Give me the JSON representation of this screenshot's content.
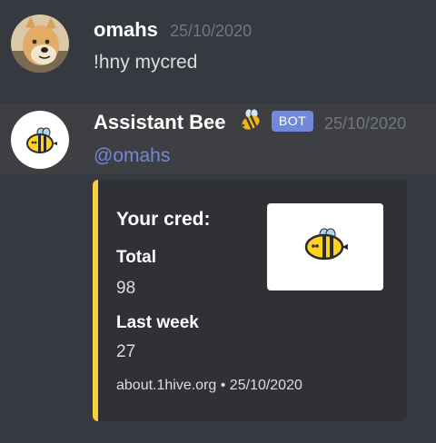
{
  "messages": [
    {
      "author": "omahs",
      "timestamp": "25/10/2020",
      "avatar_icon": "doge-avatar",
      "content": "!hny mycred"
    },
    {
      "author": "Assistant Bee",
      "author_emoji_icon": "bee-icon",
      "badge": "BOT",
      "timestamp": "25/10/2020",
      "avatar_icon": "bee-avatar",
      "mention": "@omahs",
      "embed": {
        "accent_color": "#f4d03f",
        "title": "Your cred:",
        "fields": [
          {
            "name": "Total",
            "value": "98"
          },
          {
            "name": "Last week",
            "value": "27"
          }
        ],
        "footer": "about.1hive.org • 25/10/2020",
        "thumbnail_icon": "bee-icon"
      }
    }
  ],
  "colors": {
    "background": "#36393f",
    "highlight_row": "#3e3f43",
    "embed_bg": "#2f3136",
    "mention": "#7289da",
    "bot_badge": "#7289da",
    "timestamp": "#72767d"
  }
}
